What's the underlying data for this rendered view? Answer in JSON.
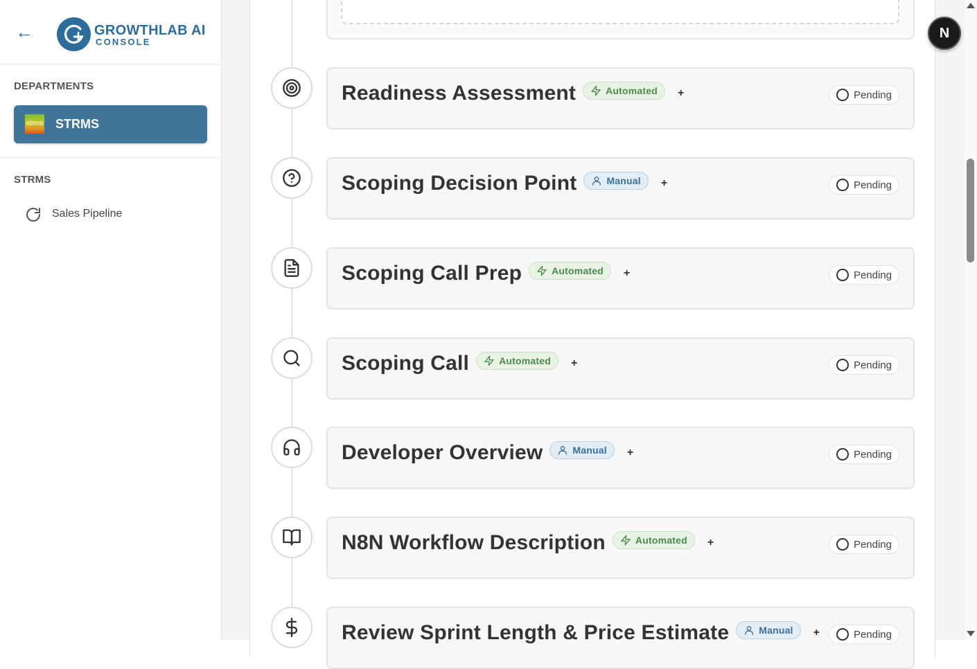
{
  "brand": {
    "back_label": "←",
    "name": "GROWTHLAB AI",
    "subtitle": "CONSOLE"
  },
  "sidebar": {
    "departments_label": "DEPARTMENTS",
    "department": {
      "logo_text": "strms",
      "name": "STRMS"
    },
    "section_label": "STRMS",
    "pipeline_label": "Sales Pipeline"
  },
  "user": {
    "avatar_initial": "N"
  },
  "steps": [
    {
      "title": "Readiness Assessment",
      "mode": "Automated",
      "icon": "target-icon",
      "status": "Pending"
    },
    {
      "title": "Scoping Decision Point",
      "mode": "Manual",
      "icon": "help-circle-icon",
      "status": "Pending"
    },
    {
      "title": "Scoping Call Prep",
      "mode": "Automated",
      "icon": "document-icon",
      "status": "Pending"
    },
    {
      "title": "Scoping Call",
      "mode": "Automated",
      "icon": "search-icon",
      "status": "Pending"
    },
    {
      "title": "Developer Overview",
      "mode": "Manual",
      "icon": "headphones-icon",
      "status": "Pending"
    },
    {
      "title": "N8N Workflow Description",
      "mode": "Automated",
      "icon": "book-open-icon",
      "status": "Pending"
    },
    {
      "title": "Review Sprint Length & Price Estimate",
      "mode": "Manual",
      "icon": "dollar-icon",
      "status": "Pending"
    }
  ],
  "add_label": "+",
  "colors": {
    "brand": "#2e6c9c",
    "department_card": "#3e7599",
    "automated": "#4d8a4a",
    "manual": "#3b6e98"
  }
}
